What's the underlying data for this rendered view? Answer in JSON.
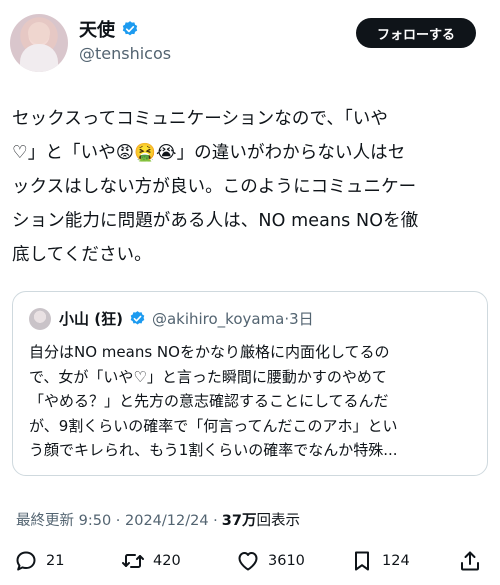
{
  "author": {
    "display_name": "天使",
    "handle": "@tenshicos",
    "verified_color": "#1d9bf0"
  },
  "follow_button": {
    "label": "フォローする"
  },
  "tweet": {
    "lines": [
      "セックスってコミュニケーションなので、「いや",
      "♡」と「いや😡🤮😭」の違いがわからない人はセ",
      "ックスはしない方が良い。このようにコミュニケー",
      "ション能力に問題がある人は、NO means NOを徹",
      "底してください。"
    ]
  },
  "quoted_tweet": {
    "display_name": "小山 (狂)",
    "handle": "@akihiro_koyama",
    "date": "·3日",
    "lines": [
      "自分はNO means NOをかなり厳格に内面化してるの",
      "で、女が「いや♡」と言った瞬間に腰動かすのやめて",
      "「やめる？」と先方の意志確認することにしてるんだ",
      "が、9割くらいの確率で「何言ってんだこのアホ」とい",
      "う顔でキレられ、もう1割くらいの確率でなんか特殊..."
    ]
  },
  "meta": {
    "timestamp": "最終更新 9:50 · 2024/12/24 ·",
    "views_count": "37万",
    "views_label": "回表示"
  },
  "actions": {
    "reply_count": "21",
    "retweet_count": "420",
    "like_count": "3610",
    "bookmark_count": "124"
  }
}
